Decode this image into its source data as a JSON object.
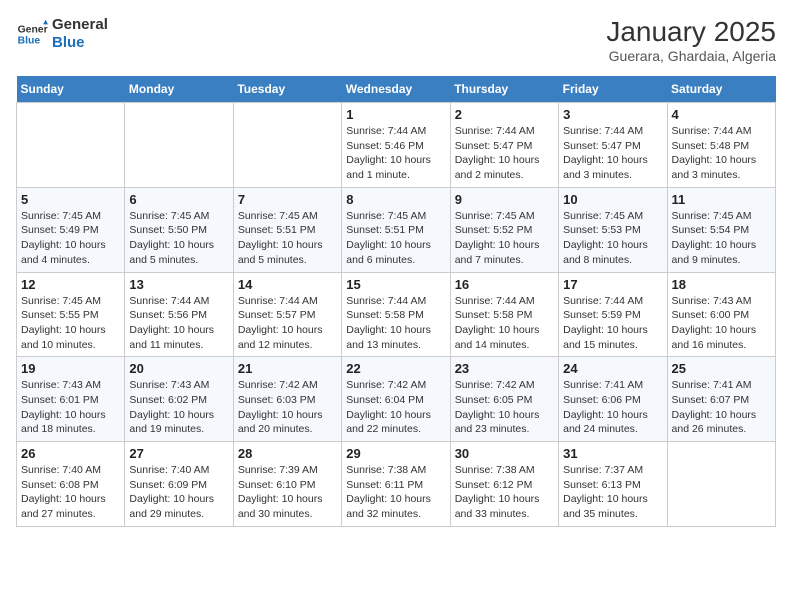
{
  "header": {
    "logo_line1": "General",
    "logo_line2": "Blue",
    "title": "January 2025",
    "subtitle": "Guerara, Ghardaia, Algeria"
  },
  "weekdays": [
    "Sunday",
    "Monday",
    "Tuesday",
    "Wednesday",
    "Thursday",
    "Friday",
    "Saturday"
  ],
  "weeks": [
    [
      {
        "day": "",
        "info": ""
      },
      {
        "day": "",
        "info": ""
      },
      {
        "day": "",
        "info": ""
      },
      {
        "day": "1",
        "info": "Sunrise: 7:44 AM\nSunset: 5:46 PM\nDaylight: 10 hours\nand 1 minute."
      },
      {
        "day": "2",
        "info": "Sunrise: 7:44 AM\nSunset: 5:47 PM\nDaylight: 10 hours\nand 2 minutes."
      },
      {
        "day": "3",
        "info": "Sunrise: 7:44 AM\nSunset: 5:47 PM\nDaylight: 10 hours\nand 3 minutes."
      },
      {
        "day": "4",
        "info": "Sunrise: 7:44 AM\nSunset: 5:48 PM\nDaylight: 10 hours\nand 3 minutes."
      }
    ],
    [
      {
        "day": "5",
        "info": "Sunrise: 7:45 AM\nSunset: 5:49 PM\nDaylight: 10 hours\nand 4 minutes."
      },
      {
        "day": "6",
        "info": "Sunrise: 7:45 AM\nSunset: 5:50 PM\nDaylight: 10 hours\nand 5 minutes."
      },
      {
        "day": "7",
        "info": "Sunrise: 7:45 AM\nSunset: 5:51 PM\nDaylight: 10 hours\nand 5 minutes."
      },
      {
        "day": "8",
        "info": "Sunrise: 7:45 AM\nSunset: 5:51 PM\nDaylight: 10 hours\nand 6 minutes."
      },
      {
        "day": "9",
        "info": "Sunrise: 7:45 AM\nSunset: 5:52 PM\nDaylight: 10 hours\nand 7 minutes."
      },
      {
        "day": "10",
        "info": "Sunrise: 7:45 AM\nSunset: 5:53 PM\nDaylight: 10 hours\nand 8 minutes."
      },
      {
        "day": "11",
        "info": "Sunrise: 7:45 AM\nSunset: 5:54 PM\nDaylight: 10 hours\nand 9 minutes."
      }
    ],
    [
      {
        "day": "12",
        "info": "Sunrise: 7:45 AM\nSunset: 5:55 PM\nDaylight: 10 hours\nand 10 minutes."
      },
      {
        "day": "13",
        "info": "Sunrise: 7:44 AM\nSunset: 5:56 PM\nDaylight: 10 hours\nand 11 minutes."
      },
      {
        "day": "14",
        "info": "Sunrise: 7:44 AM\nSunset: 5:57 PM\nDaylight: 10 hours\nand 12 minutes."
      },
      {
        "day": "15",
        "info": "Sunrise: 7:44 AM\nSunset: 5:58 PM\nDaylight: 10 hours\nand 13 minutes."
      },
      {
        "day": "16",
        "info": "Sunrise: 7:44 AM\nSunset: 5:58 PM\nDaylight: 10 hours\nand 14 minutes."
      },
      {
        "day": "17",
        "info": "Sunrise: 7:44 AM\nSunset: 5:59 PM\nDaylight: 10 hours\nand 15 minutes."
      },
      {
        "day": "18",
        "info": "Sunrise: 7:43 AM\nSunset: 6:00 PM\nDaylight: 10 hours\nand 16 minutes."
      }
    ],
    [
      {
        "day": "19",
        "info": "Sunrise: 7:43 AM\nSunset: 6:01 PM\nDaylight: 10 hours\nand 18 minutes."
      },
      {
        "day": "20",
        "info": "Sunrise: 7:43 AM\nSunset: 6:02 PM\nDaylight: 10 hours\nand 19 minutes."
      },
      {
        "day": "21",
        "info": "Sunrise: 7:42 AM\nSunset: 6:03 PM\nDaylight: 10 hours\nand 20 minutes."
      },
      {
        "day": "22",
        "info": "Sunrise: 7:42 AM\nSunset: 6:04 PM\nDaylight: 10 hours\nand 22 minutes."
      },
      {
        "day": "23",
        "info": "Sunrise: 7:42 AM\nSunset: 6:05 PM\nDaylight: 10 hours\nand 23 minutes."
      },
      {
        "day": "24",
        "info": "Sunrise: 7:41 AM\nSunset: 6:06 PM\nDaylight: 10 hours\nand 24 minutes."
      },
      {
        "day": "25",
        "info": "Sunrise: 7:41 AM\nSunset: 6:07 PM\nDaylight: 10 hours\nand 26 minutes."
      }
    ],
    [
      {
        "day": "26",
        "info": "Sunrise: 7:40 AM\nSunset: 6:08 PM\nDaylight: 10 hours\nand 27 minutes."
      },
      {
        "day": "27",
        "info": "Sunrise: 7:40 AM\nSunset: 6:09 PM\nDaylight: 10 hours\nand 29 minutes."
      },
      {
        "day": "28",
        "info": "Sunrise: 7:39 AM\nSunset: 6:10 PM\nDaylight: 10 hours\nand 30 minutes."
      },
      {
        "day": "29",
        "info": "Sunrise: 7:38 AM\nSunset: 6:11 PM\nDaylight: 10 hours\nand 32 minutes."
      },
      {
        "day": "30",
        "info": "Sunrise: 7:38 AM\nSunset: 6:12 PM\nDaylight: 10 hours\nand 33 minutes."
      },
      {
        "day": "31",
        "info": "Sunrise: 7:37 AM\nSunset: 6:13 PM\nDaylight: 10 hours\nand 35 minutes."
      },
      {
        "day": "",
        "info": ""
      }
    ]
  ]
}
